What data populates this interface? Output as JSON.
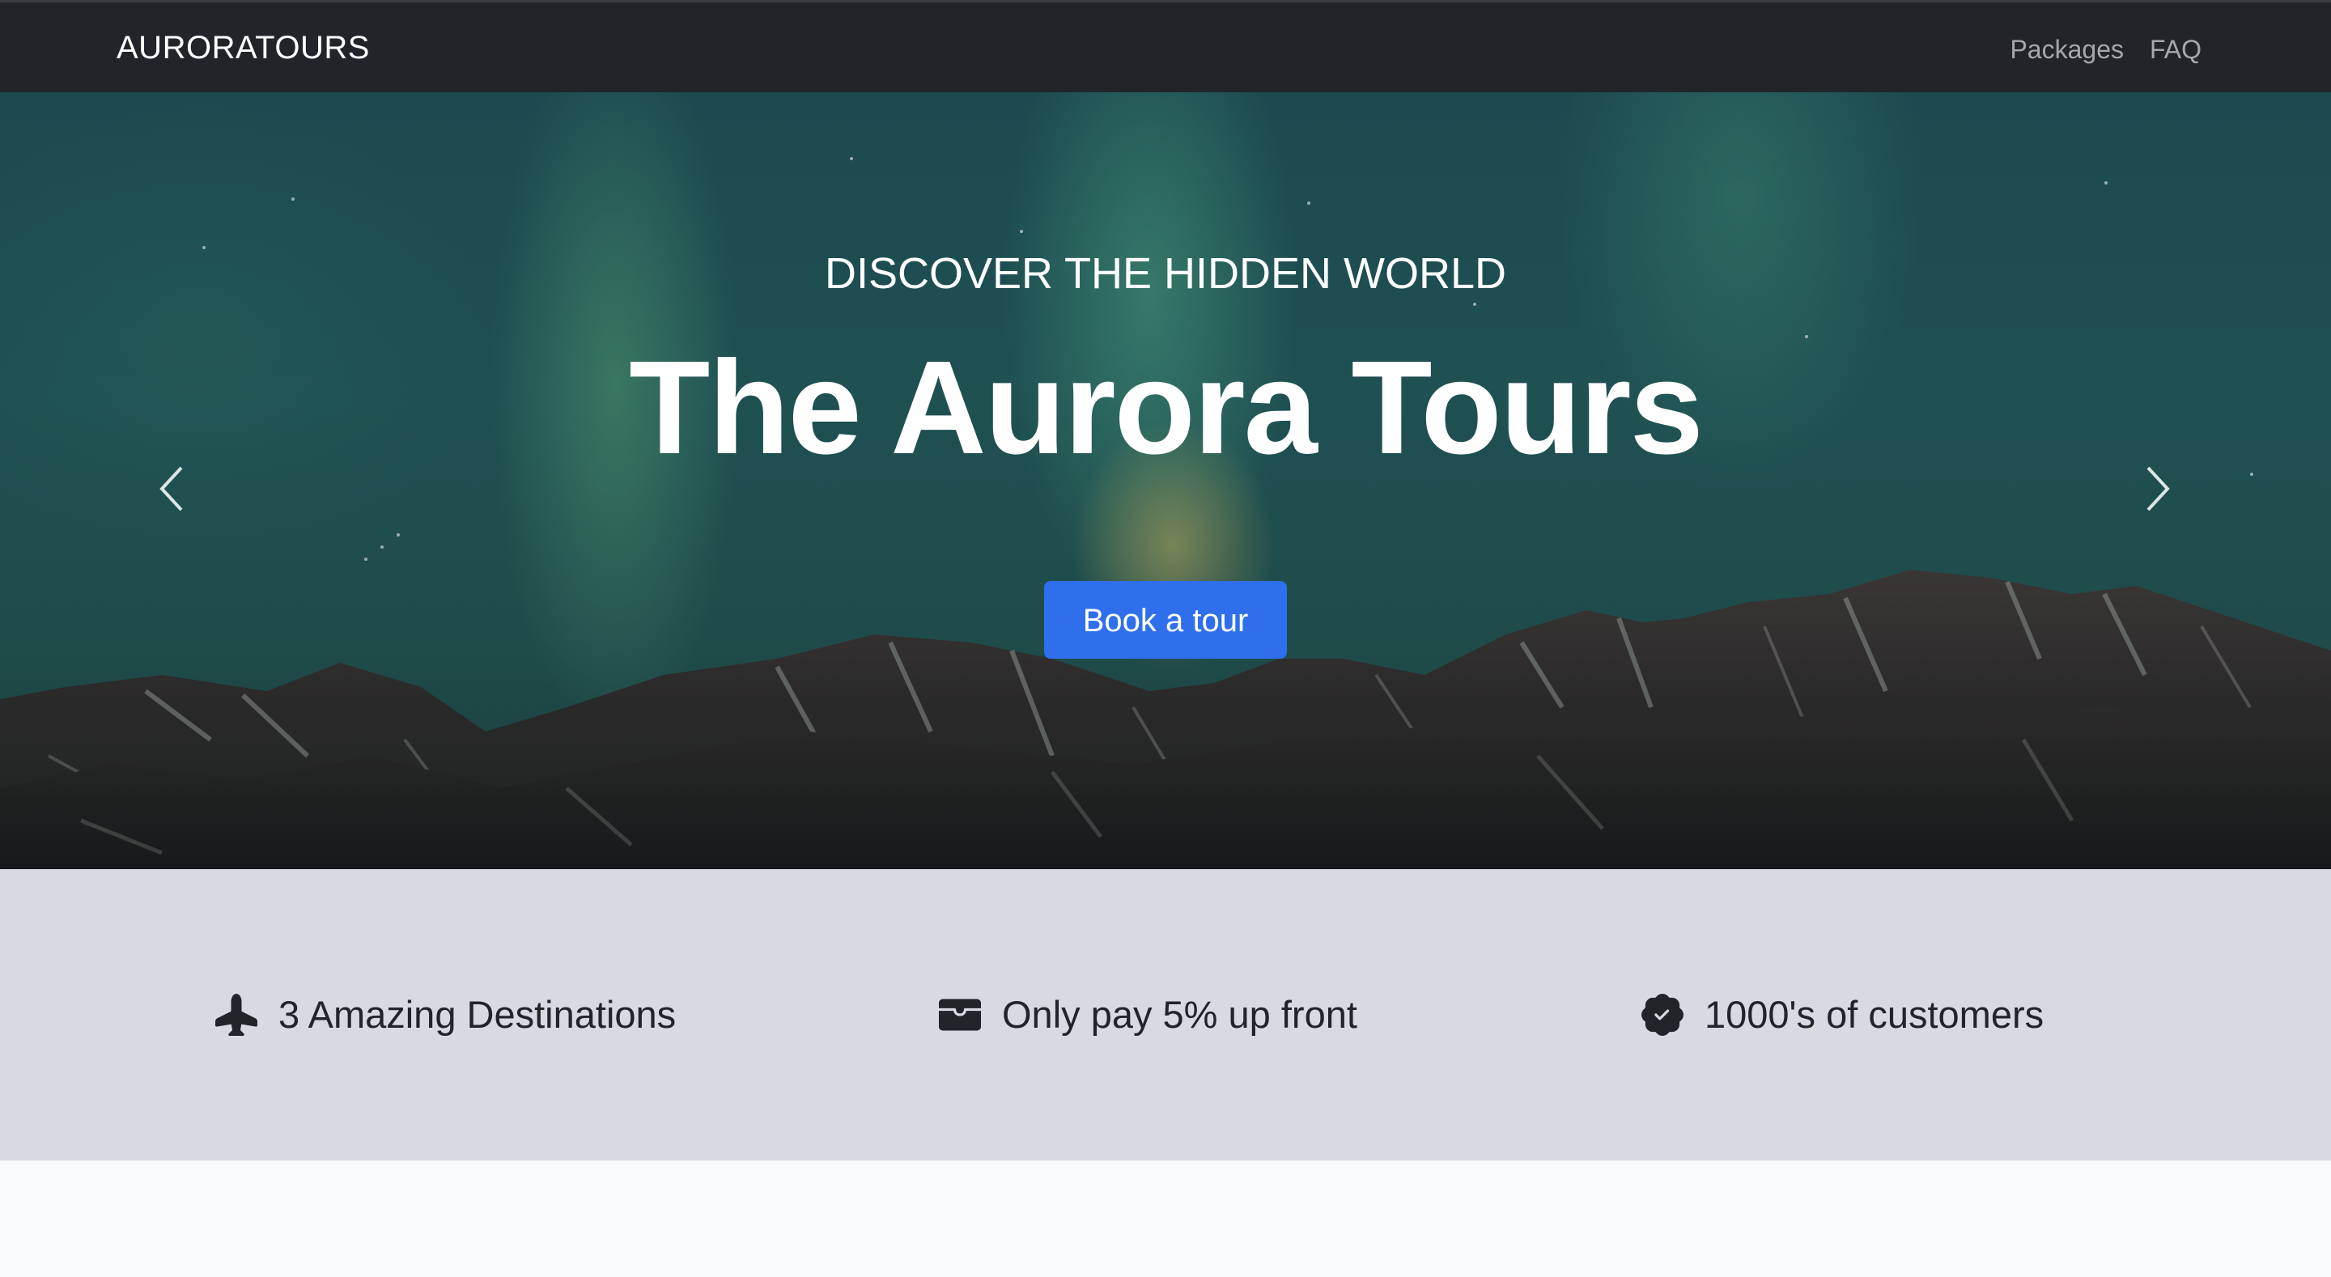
{
  "navbar": {
    "brand": "AURORATOURS",
    "links": [
      "Packages",
      "FAQ"
    ]
  },
  "hero": {
    "subtitle": "DISCOVER THE HIDDEN WORLD",
    "title": "The Aurora Tours",
    "cta_label": "Book a tour",
    "prev_icon": "chevron-left-icon",
    "next_icon": "chevron-right-icon"
  },
  "features": [
    {
      "icon": "airplane-icon",
      "label": "3 Amazing Destinations"
    },
    {
      "icon": "wallet-icon",
      "label": "Only pay 5% up front"
    },
    {
      "icon": "patch-check-icon",
      "label": "1000's of customers"
    }
  ],
  "colors": {
    "navbar_bg": "#212529",
    "primary_button": "#2f6fec",
    "features_bg": "#d7dbe1",
    "page_bg": "#f8f9fa"
  }
}
